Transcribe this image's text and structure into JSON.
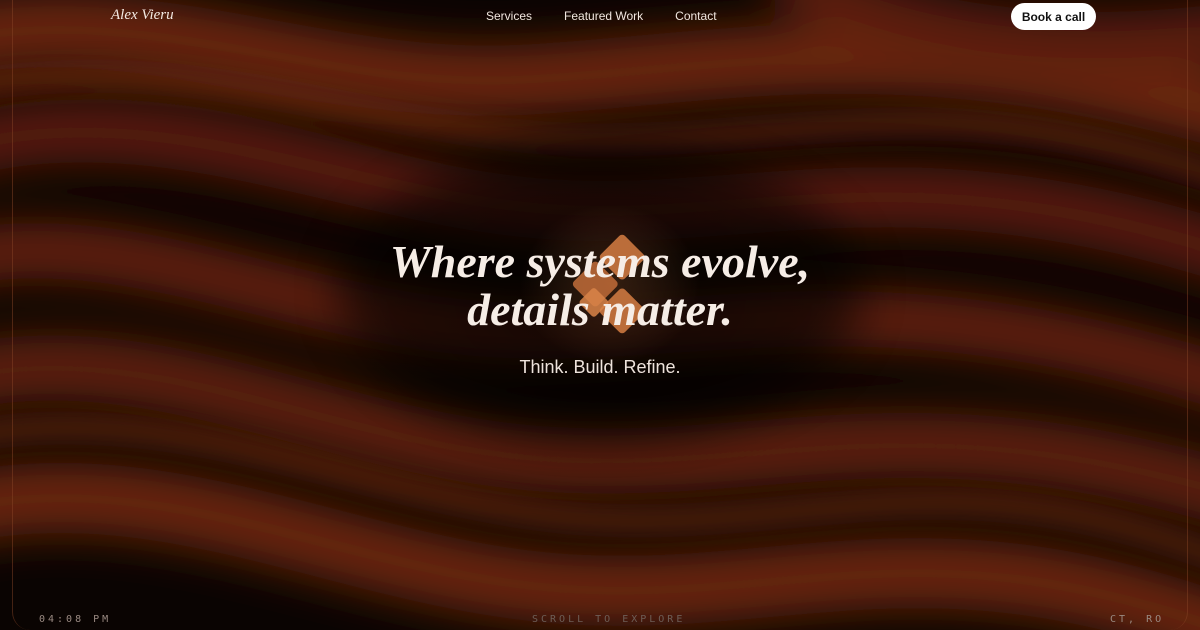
{
  "header": {
    "brand": "Alex Vieru",
    "nav": [
      {
        "label": "Services"
      },
      {
        "label": "Featured Work"
      },
      {
        "label": "Contact"
      }
    ],
    "cta_label": "Book a call"
  },
  "hero": {
    "headline_line1": "Where systems evolve,",
    "headline_line2": "details matter.",
    "tagline": "Think. Build. Refine."
  },
  "footer": {
    "time": "04:08 PM",
    "scroll_hint": "SCROLL TO EXPLORE",
    "location": "CT, RO"
  },
  "colors": {
    "background": "#080402",
    "wave": "#6a2410",
    "accent": "#c8753f",
    "text": "#f6ede6",
    "cta_bg": "#ffffff"
  }
}
